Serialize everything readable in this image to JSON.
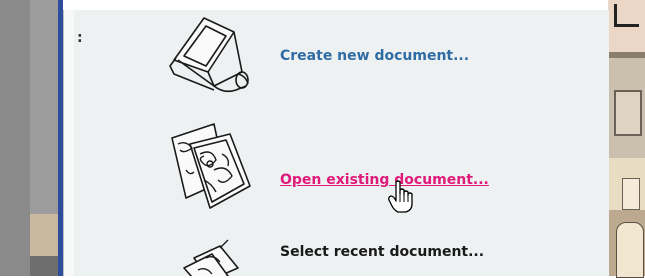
{
  "menu": {
    "items": [
      {
        "label": "Create new document...",
        "icon": "new-document-icon",
        "state": "normal",
        "color": "#2f6ca3"
      },
      {
        "label": "Open existing document...",
        "icon": "open-document-icon",
        "state": "hover",
        "color": "#e01a7a"
      },
      {
        "label": "Select recent document...",
        "icon": "recent-documents-icon",
        "state": "normal",
        "color": "#1a1a1a"
      }
    ]
  },
  "cursor": {
    "type": "hand-pointer"
  },
  "colors": {
    "panel_bg": "#eef1f2",
    "link_hover": "#e01a7a",
    "link": "#2f6ca3"
  }
}
